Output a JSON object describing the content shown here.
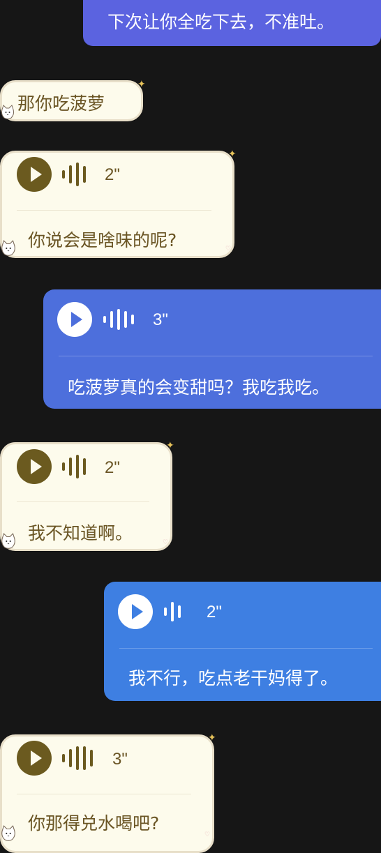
{
  "messages": [
    {
      "type": "text",
      "from": "me",
      "text": "下次让你全吃下去，不准吐。"
    },
    {
      "type": "text",
      "from": "other",
      "text": "那你吃菠萝"
    },
    {
      "type": "voice",
      "from": "other",
      "duration": "2\"",
      "transcript": "你说会是啥味的呢?"
    },
    {
      "type": "voice",
      "from": "me",
      "duration": "3\"",
      "transcript": "吃菠萝真的会变甜吗？我吃我吃。"
    },
    {
      "type": "voice",
      "from": "other",
      "duration": "2\"",
      "transcript": "我不知道啊。"
    },
    {
      "type": "voice",
      "from": "me",
      "duration": "2\"",
      "transcript": "我不行，吃点老干妈得了。"
    },
    {
      "type": "voice",
      "from": "other",
      "duration": "3\"",
      "transcript": "你那得兑水喝吧?"
    }
  ],
  "icons": {
    "play": "play-icon",
    "waveform": "voice-waveform-icon",
    "sticker": "cat-sticker-icon",
    "sparkle": "sparkle-icon"
  },
  "colors": {
    "background": "#161616",
    "received_bubble": "#fdfbec",
    "received_text": "#6a5524",
    "sent_bubble_1": "#5b63e0",
    "sent_bubble_2": "#4d6fdc",
    "sent_bubble_3": "#3e7fe2"
  }
}
